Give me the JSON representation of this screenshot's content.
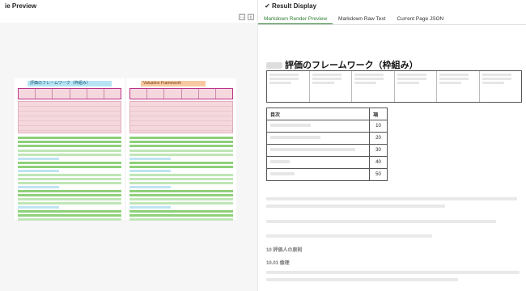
{
  "left_panel": {
    "title": "ie Preview",
    "tools": [
      "⛶",
      "⤓"
    ],
    "page_left_title": "評価のフレームワーク（枠組み）",
    "page_right_title": "Valuation Framework"
  },
  "right_panel": {
    "title": "Result Display",
    "title_icon": "check-icon",
    "tabs": [
      {
        "label": "Markdown Render Preview",
        "active": true
      },
      {
        "label": "Markdown Raw Text",
        "active": false
      },
      {
        "label": "Current Page JSON",
        "active": false
      }
    ],
    "heading": "評価のフレームワーク（枠組み）",
    "toc_table": {
      "headers": [
        "目次",
        "項"
      ],
      "rows": [
        {
          "num": "10"
        },
        {
          "num": "20"
        },
        {
          "num": "30"
        },
        {
          "num": "40"
        },
        {
          "num": "50"
        }
      ]
    },
    "subheadings": [
      "10 評価人の原則",
      "10.01 倫理"
    ]
  },
  "colors": {
    "accent_green": "#2e7d32",
    "highlight_blue": "#b7e4f4",
    "highlight_pink": "#f5d8de",
    "highlight_green": "#bfe6b6"
  }
}
